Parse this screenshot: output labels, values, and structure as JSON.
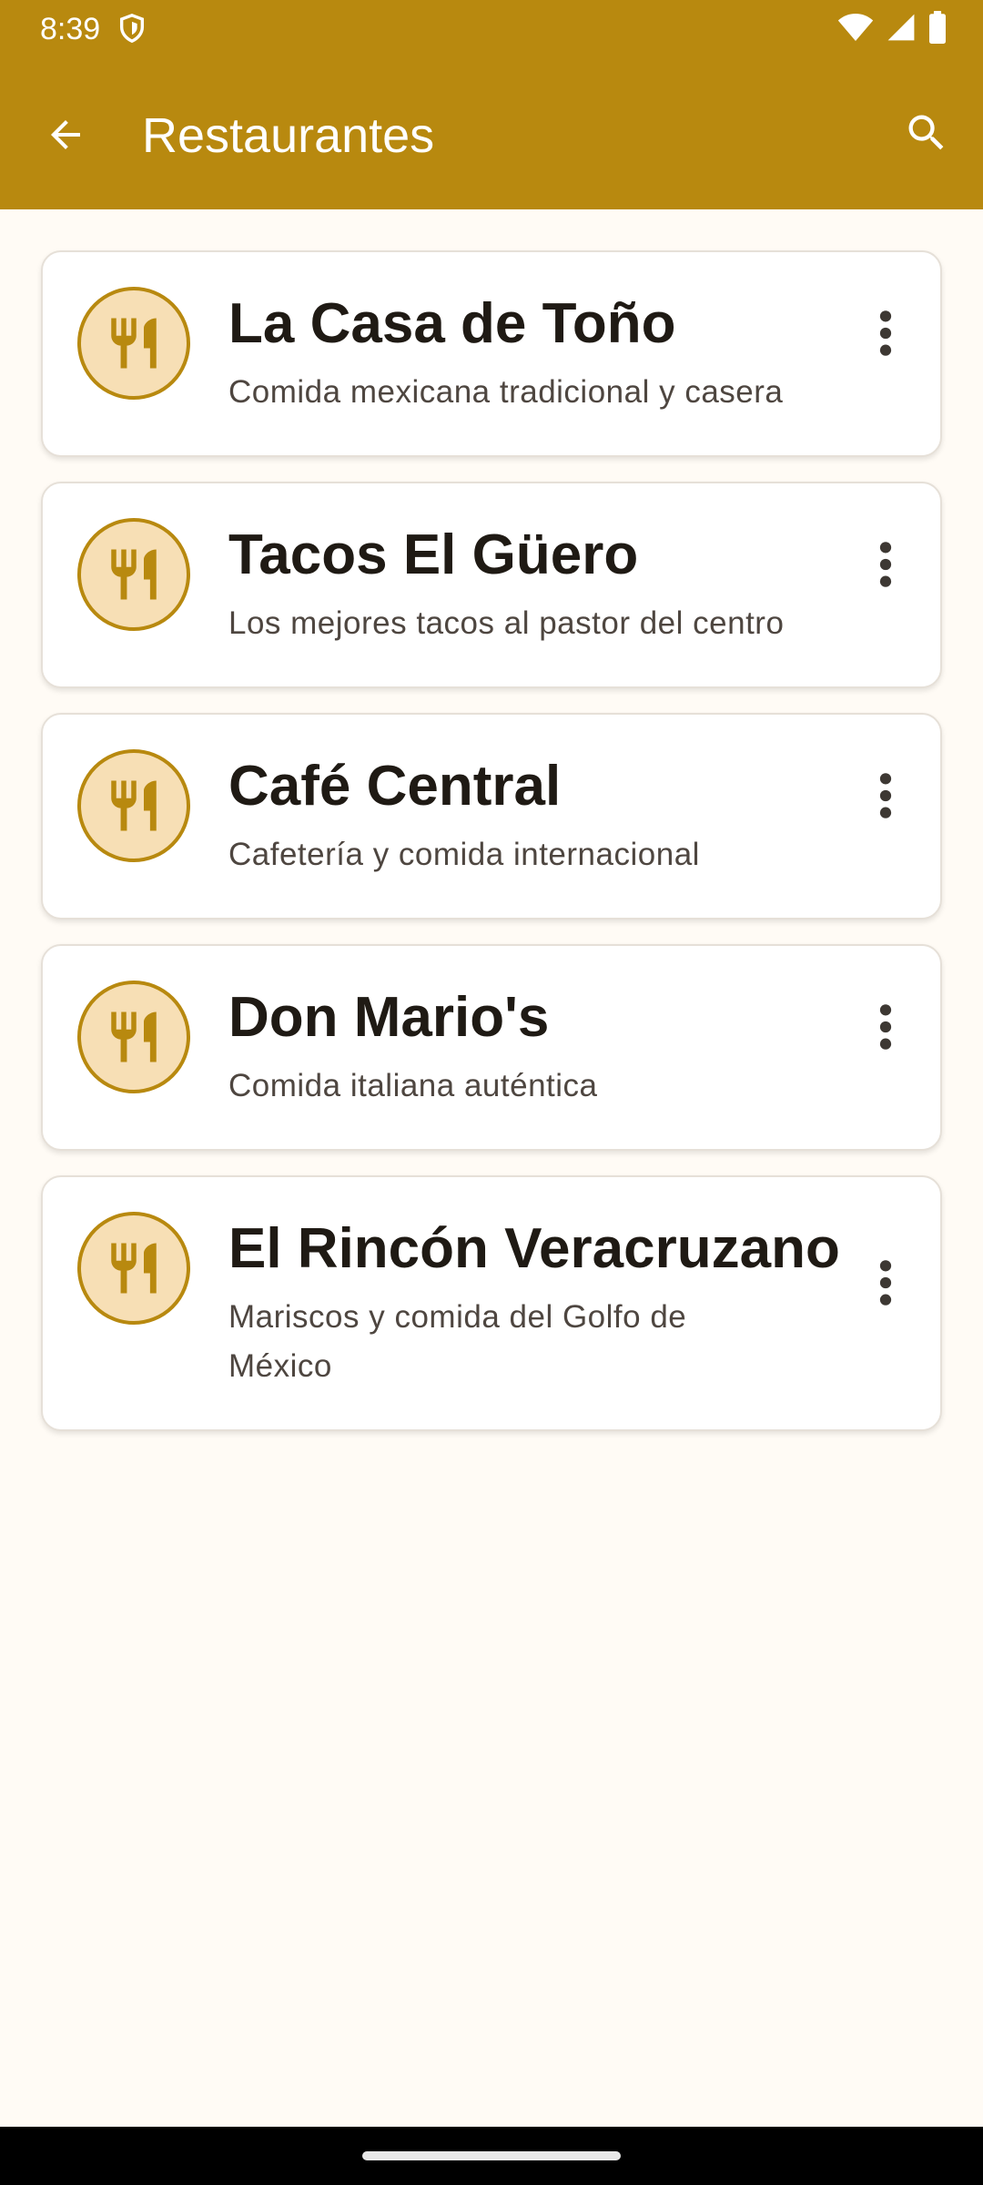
{
  "status_bar": {
    "time": "8:39"
  },
  "toolbar": {
    "title": "Restaurantes",
    "back_icon": "arrow-back-icon",
    "search_icon": "search-icon"
  },
  "colors": {
    "primary": "#B8890F",
    "avatar_fill": "#F7DFB5",
    "background": "#FFFBF5"
  },
  "restaurants": [
    {
      "name": "La Casa de Toño",
      "description": "Comida mexicana tradicional y casera"
    },
    {
      "name": "Tacos El Güero",
      "description": "Los mejores tacos al pastor del centro"
    },
    {
      "name": "Café Central",
      "description": "Cafetería y comida internacional"
    },
    {
      "name": "Don Mario's",
      "description": "Comida italiana auténtica"
    },
    {
      "name": "El Rincón Veracruzano",
      "description": "Mariscos y comida del Golfo de México"
    }
  ],
  "item_icon": "restaurant-icon",
  "item_menu_icon": "more-vert-icon"
}
